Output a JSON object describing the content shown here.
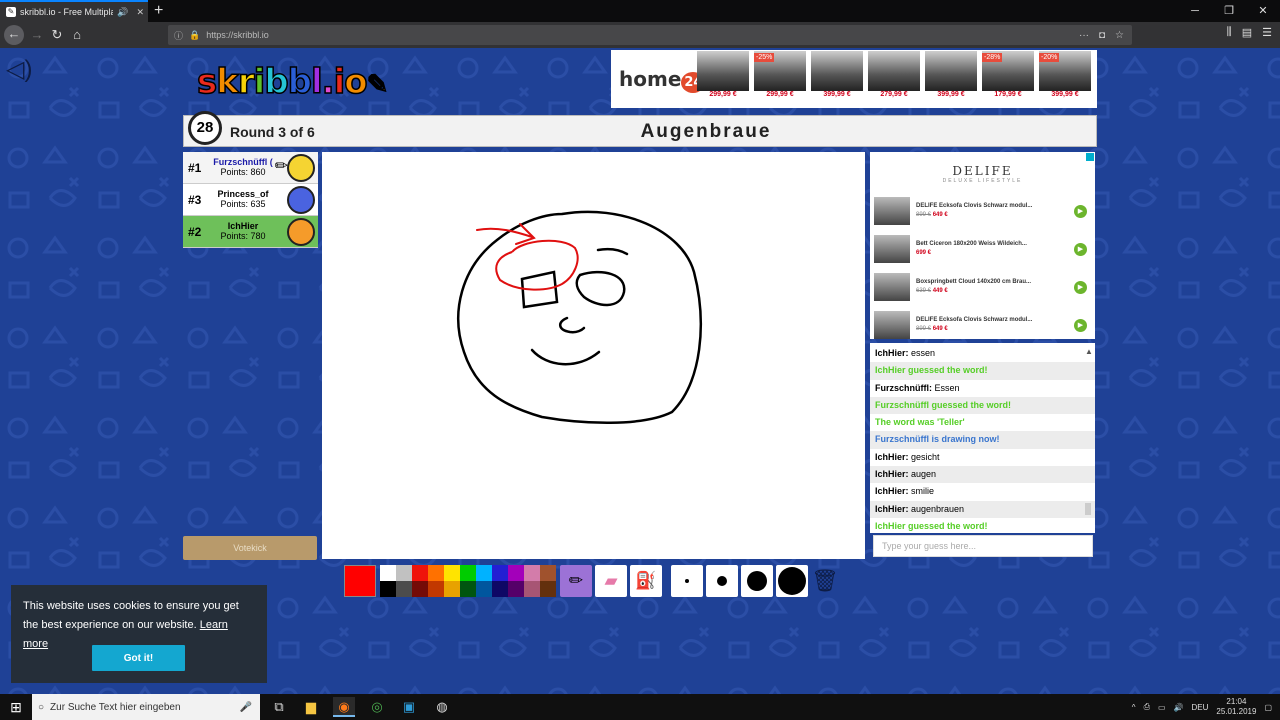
{
  "browser": {
    "tab_title": "skribbl.io - Free Multiplaye",
    "url": "https://skribbl.io"
  },
  "game": {
    "logo_text": [
      "s",
      "k",
      "r",
      "i",
      "b",
      "b",
      "l",
      ".",
      "i",
      "o"
    ],
    "logo_colors": [
      "#ea2a1c",
      "#f28c00",
      "#f7d108",
      "#5ec12a",
      "#26c3d4",
      "#2a5ed6",
      "#a22ee0",
      "#e14ad1",
      "#ea2a1c",
      "#f28c00"
    ],
    "timer": "28",
    "round_text": "Round 3 of 6",
    "word": "Augenbraue",
    "votekick_label": "Votekick"
  },
  "players": [
    {
      "rank": "#1",
      "name": "Furzschnüffl (",
      "points": "Points: 860",
      "name_color": "#1a1aa8",
      "bg": "#f4f4f4",
      "avatar_color": "#f5d432",
      "drawing": true
    },
    {
      "rank": "#3",
      "name": "Princess_of",
      "points": "Points: 635",
      "name_color": "#000000",
      "bg": "#ffffff",
      "avatar_color": "#4a63e0",
      "drawing": false
    },
    {
      "rank": "#2",
      "name": "IchHier",
      "points": "Points: 780",
      "name_color": "#000000",
      "bg": "#6ec05a",
      "avatar_color": "#f59b2a",
      "drawing": false
    }
  ],
  "palette": {
    "current": "#ff0000",
    "row1": [
      "#ffffff",
      "#c1c1c1",
      "#ef130b",
      "#ff7100",
      "#ffe400",
      "#00cc00",
      "#00b2ff",
      "#231fd3",
      "#a300ba",
      "#d37caa",
      "#a0522d"
    ],
    "row2": [
      "#000000",
      "#4c4c4c",
      "#740b07",
      "#c23800",
      "#e8a200",
      "#005510",
      "#00569e",
      "#0e0865",
      "#550069",
      "#a75574",
      "#63300d"
    ]
  },
  "tools": [
    "pencil-icon",
    "eraser-icon",
    "fill-icon"
  ],
  "brush_sizes": [
    4,
    10,
    20,
    28
  ],
  "ad_top": {
    "brand": "home",
    "brand_badge": "24",
    "products": [
      {
        "price": "299,99 €",
        "discount": ""
      },
      {
        "price": "299,99 €",
        "discount": "-25%"
      },
      {
        "price": "399,99 €",
        "discount": ""
      },
      {
        "price": "279,99 €",
        "discount": ""
      },
      {
        "price": "399,99 €",
        "discount": ""
      },
      {
        "price": "179,99 €",
        "discount": "-28%"
      },
      {
        "price": "399,99 €",
        "discount": "-20%"
      }
    ]
  },
  "ad_side": {
    "brand": "DELIFE",
    "sub": "DELUXE LIFESTYLE",
    "items": [
      {
        "title": "DELIFE Ecksofa Clovis Schwarz modul...",
        "old": "899 €",
        "new": "649 €"
      },
      {
        "title": "Bett Ciceron 180x200 Weiss Wildeich...",
        "old": "",
        "new": "699 €"
      },
      {
        "title": "Boxspringbett Cloud 140x200 cm Brau...",
        "old": "639 €",
        "new": "449 €"
      },
      {
        "title": "DELIFE Ecksofa Clovis Schwarz modul...",
        "old": "899 €",
        "new": "649 €"
      }
    ]
  },
  "chat": [
    {
      "name": "IchHier: ",
      "text": "essen",
      "type": "msg"
    },
    {
      "name": "",
      "text": "IchHier guessed the word!",
      "type": "guess"
    },
    {
      "name": "Furzschnüffl: ",
      "text": "Essen",
      "type": "msg"
    },
    {
      "name": "",
      "text": "Furzschnüffl guessed the word!",
      "type": "guess"
    },
    {
      "name": "",
      "text": "The word was 'Teller'",
      "type": "guess"
    },
    {
      "name": "",
      "text": "Furzschnüffl is drawing now!",
      "type": "draw"
    },
    {
      "name": "IchHier: ",
      "text": "gesicht",
      "type": "msg"
    },
    {
      "name": "IchHier: ",
      "text": "augen",
      "type": "msg"
    },
    {
      "name": "IchHier: ",
      "text": "smilie",
      "type": "msg"
    },
    {
      "name": "IchHier: ",
      "text": "augenbrauen",
      "type": "msg"
    },
    {
      "name": "",
      "text": "IchHier guessed the word!",
      "type": "guess"
    }
  ],
  "guess_placeholder": "Type your guess here...",
  "cookie": {
    "text": "This website uses cookies to ensure you get the best experience on our website.",
    "link": "Learn more",
    "button": "Got it!"
  },
  "taskbar": {
    "search_placeholder": "Zur Suche Text hier eingeben",
    "lang": "DEU",
    "time": "21:04",
    "date": "25.01.2019"
  }
}
